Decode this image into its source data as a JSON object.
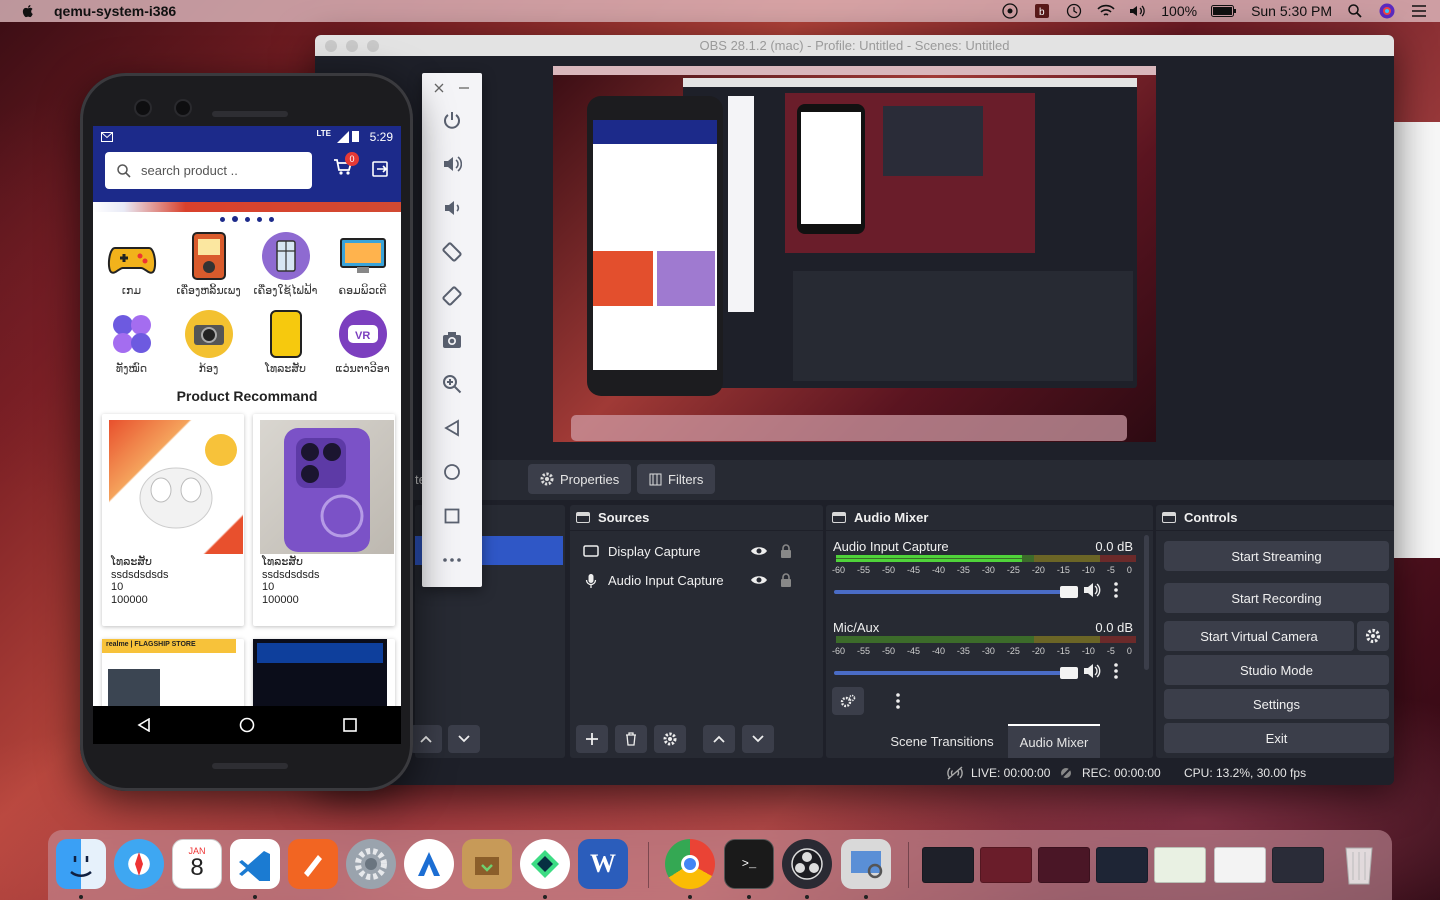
{
  "menubar": {
    "app_name": "qemu-system-i386",
    "battery": "100%",
    "clock": "Sun 5:30 PM"
  },
  "obs": {
    "window_title": "OBS 28.1.2 (mac) - Profile: Untitled - Scenes: Untitled",
    "properties_label": "Properties",
    "filters_label": "Filters",
    "sources_title": "Sources",
    "sources": [
      {
        "name": "Display Capture",
        "icon": "monitor-icon"
      },
      {
        "name": "Audio Input Capture",
        "icon": "microphone-icon"
      }
    ],
    "mixer_title": "Audio Mixer",
    "mixer_channels": [
      {
        "name": "Audio Input Capture",
        "db": "0.0 dB",
        "level": 0.62
      },
      {
        "name": "Mic/Aux",
        "db": "0.0 dB",
        "level": 0.0
      }
    ],
    "meter_scale": [
      "-60",
      "-55",
      "-50",
      "-45",
      "-40",
      "-35",
      "-30",
      "-25",
      "-20",
      "-15",
      "-10",
      "-5",
      "0"
    ],
    "controls_title": "Controls",
    "controls": {
      "start_streaming": "Start Streaming",
      "start_recording": "Start Recording",
      "start_virtual_camera": "Start Virtual Camera",
      "studio_mode": "Studio Mode",
      "settings": "Settings",
      "exit": "Exit"
    },
    "mixer_tabs": {
      "scene_transitions": "Scene Transitions",
      "audio_mixer": "Audio Mixer"
    },
    "scenes_partial_label": "te",
    "status": {
      "live": "LIVE: 00:00:00",
      "rec": "REC: 00:00:00",
      "cpu": "CPU: 13.2%, 30.00 fps"
    }
  },
  "phone": {
    "status_time": "5:29",
    "status_network": "LTE",
    "search_placeholder": "search product ..",
    "cart_badge": "0",
    "categories": [
      {
        "label": "ເກມ",
        "icon": "gamepad-icon"
      },
      {
        "label": "ເຄື່ອງຫລິ້ນເພງ",
        "icon": "music-player-icon"
      },
      {
        "label": "ເຄື່ອງໃຊ້ໄຟຟ້າ",
        "icon": "fridge-icon"
      },
      {
        "label": "ຄອມພິວເຕີ",
        "icon": "computer-icon"
      },
      {
        "label": "ທັງໝົດ",
        "icon": "all-categories-icon"
      },
      {
        "label": "ກ້ອງ",
        "icon": "camera-icon"
      },
      {
        "label": "ໂທລະສັບ",
        "icon": "phone-icon"
      },
      {
        "label": "ແວ່ນຕາວີອາ",
        "icon": "vr-icon"
      }
    ],
    "section_title": "Product Recommand",
    "products": [
      {
        "category": "ໂທລະສັບ",
        "name": "ssdsdsdsds",
        "qty": "10",
        "price": "100000",
        "image": "earbuds-image"
      },
      {
        "category": "ໂທລະສັບ",
        "name": "ssdsdsdsds",
        "qty": "10",
        "price": "100000",
        "image": "purple-iphone-image"
      }
    ],
    "banner_store": "realme | FLAGSHIP STORE"
  },
  "dock": {
    "calendar_month": "JAN",
    "calendar_day": "8"
  }
}
